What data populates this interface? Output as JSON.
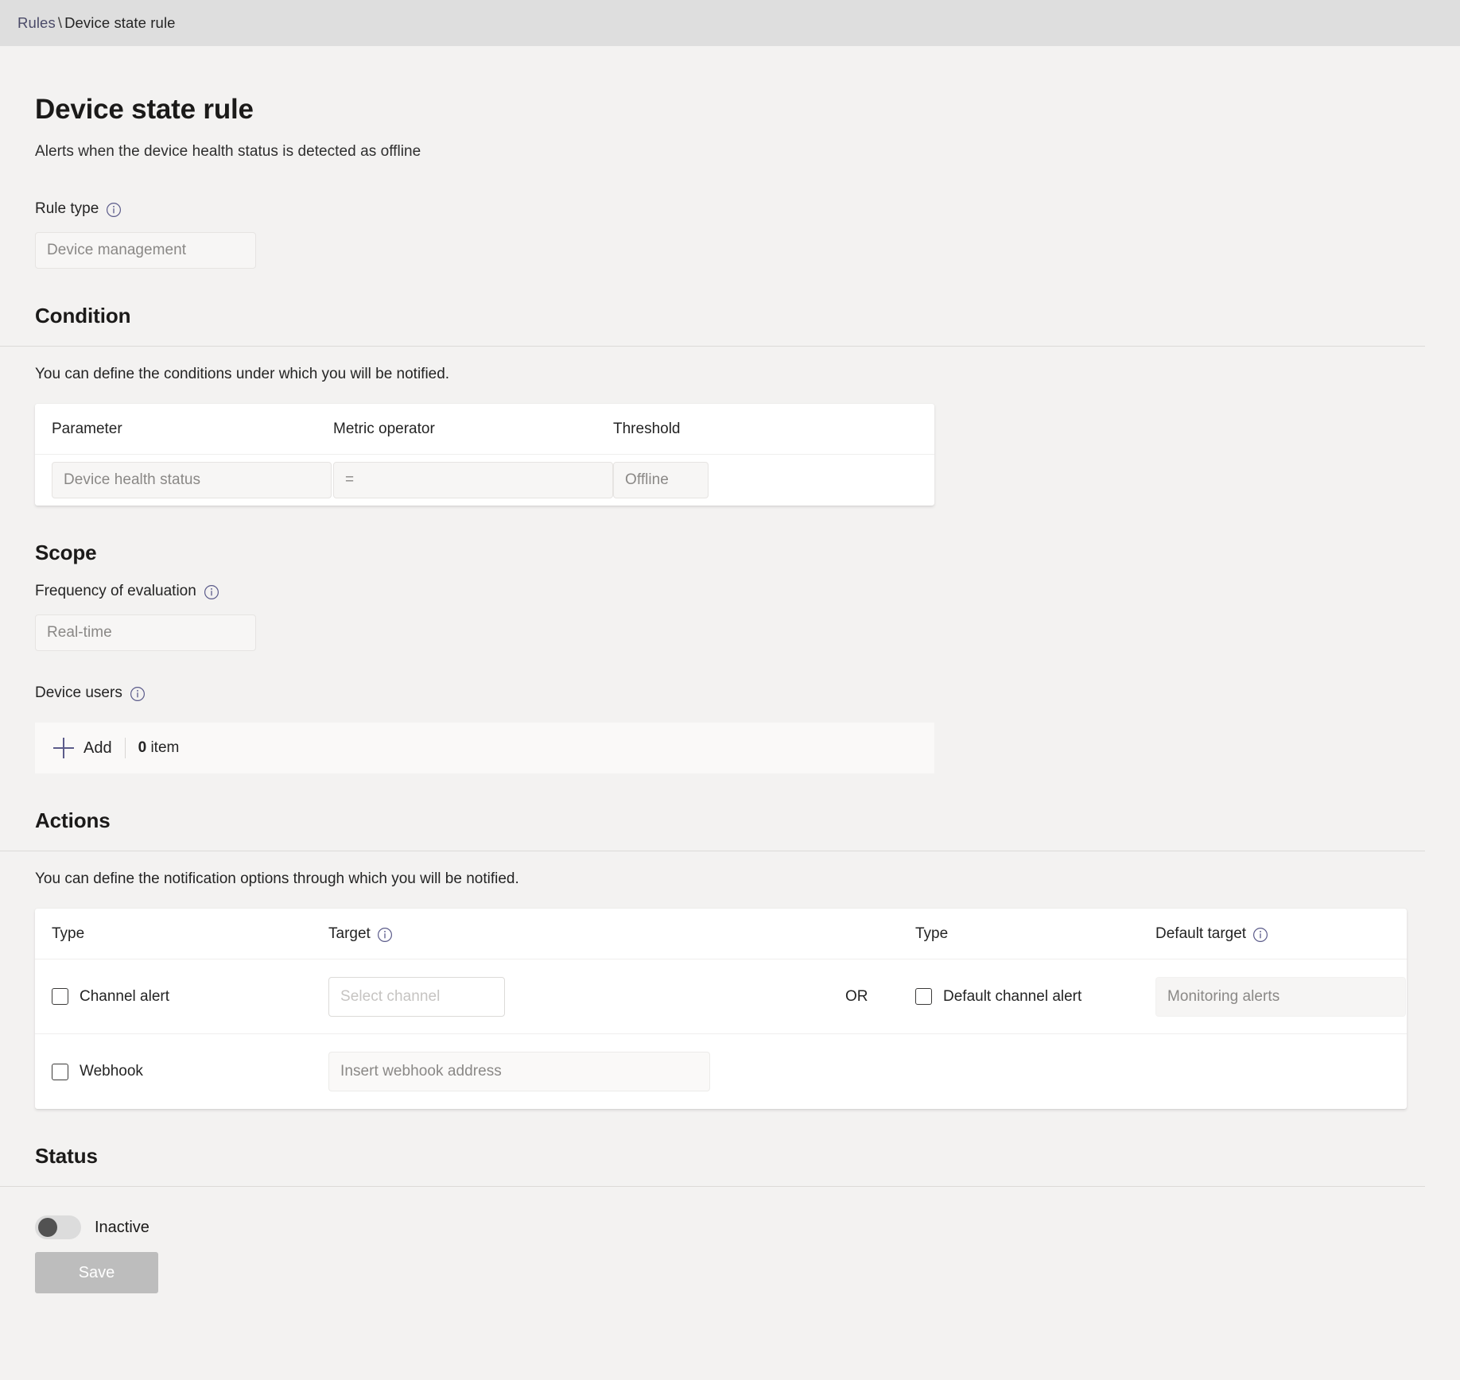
{
  "breadcrumb": {
    "parent": "Rules",
    "separator": "\\",
    "current": "Device state rule"
  },
  "header": {
    "title": "Device state rule",
    "subtitle": "Alerts when the device health status is detected as offline"
  },
  "rule_type": {
    "label": "Rule type",
    "info_icon": "info-icon",
    "value": "Device management"
  },
  "condition": {
    "title": "Condition",
    "description": "You can define the conditions under which you will be notified.",
    "columns": [
      "Parameter",
      "Metric operator",
      "Threshold"
    ],
    "row": {
      "parameter": "Device health status",
      "operator": "=",
      "threshold": "Offline"
    }
  },
  "scope": {
    "title": "Scope",
    "frequency_label": "Frequency of evaluation",
    "frequency_value": "Real-time",
    "device_users_label": "Device users",
    "add_label": "Add",
    "item_count": "0",
    "item_word": "item"
  },
  "actions": {
    "title": "Actions",
    "description": "You can define the notification options through which you will be notified.",
    "columns": {
      "type1": "Type",
      "target": "Target",
      "type2": "Type",
      "default_target": "Default target"
    },
    "or_label": "OR",
    "rows": [
      {
        "type": "Channel alert",
        "target_placeholder": "Select channel",
        "right_type": "Default channel alert",
        "default_target_value": "Monitoring alerts"
      },
      {
        "type": "Webhook",
        "target_placeholder": "Insert webhook address"
      }
    ]
  },
  "status": {
    "title": "Status",
    "toggle_state": "Inactive",
    "save_label": "Save"
  },
  "colors": {
    "accent": "#5b5b8a",
    "page_bg": "#f3f2f1",
    "breadcrumb_bg": "#dedede",
    "card_bg": "#ffffff",
    "disabled_button": "#bdbdbd"
  }
}
